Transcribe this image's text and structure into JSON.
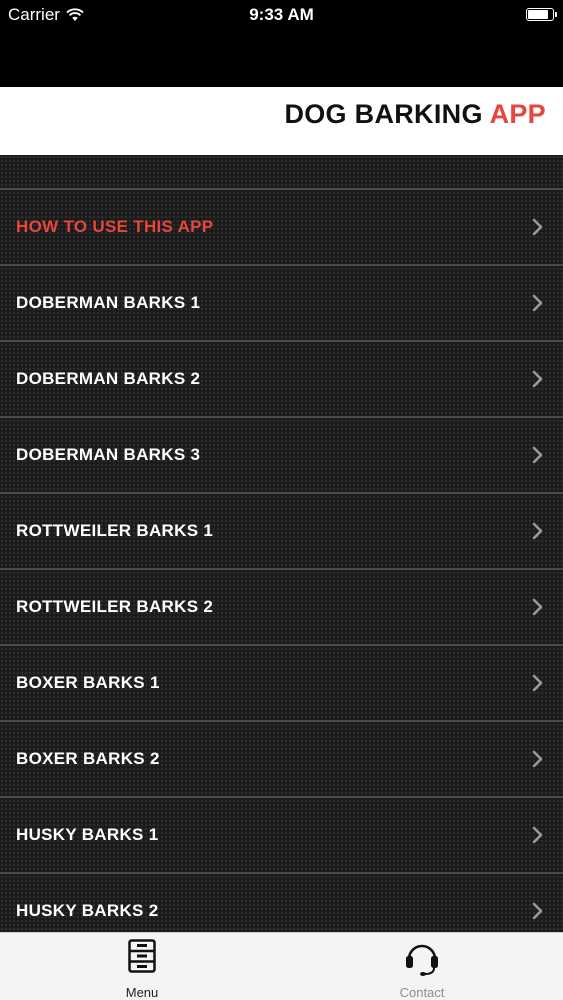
{
  "status_bar": {
    "carrier": "Carrier",
    "time": "9:33 AM",
    "battery_level": 0.85
  },
  "header": {
    "title_main": "DOG BARKING",
    "title_accent": "APP",
    "accent_color": "#e5473c"
  },
  "menu": {
    "items": [
      {
        "label": "HOW TO USE THIS APP",
        "highlight": true
      },
      {
        "label": "DOBERMAN BARKS 1"
      },
      {
        "label": "DOBERMAN BARKS 2"
      },
      {
        "label": "DOBERMAN BARKS 3"
      },
      {
        "label": "ROTTWEILER BARKS 1"
      },
      {
        "label": "ROTTWEILER BARKS 2"
      },
      {
        "label": "BOXER BARKS 1"
      },
      {
        "label": "BOXER BARKS 2"
      },
      {
        "label": "HUSKY BARKS 1"
      },
      {
        "label": "HUSKY BARKS 2"
      }
    ]
  },
  "tab_bar": {
    "tabs": [
      {
        "label": "Menu",
        "icon": "file-cabinet-icon",
        "active": true
      },
      {
        "label": "Contact",
        "icon": "headset-icon",
        "active": false
      }
    ]
  }
}
